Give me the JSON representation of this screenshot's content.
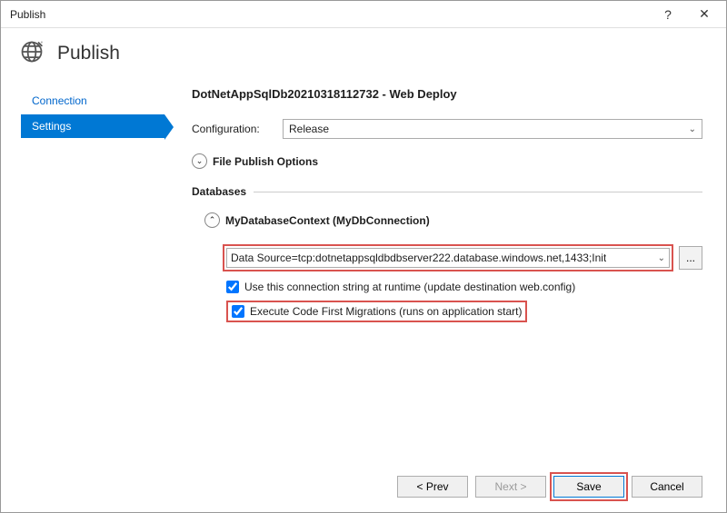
{
  "window": {
    "title": "Publish"
  },
  "titlebar": {
    "help_symbol": "?",
    "close_symbol": "✕"
  },
  "header": {
    "title": "Publish"
  },
  "sidebar": {
    "items": [
      {
        "label": "Connection",
        "active": false
      },
      {
        "label": "Settings",
        "active": true
      }
    ]
  },
  "main": {
    "page_title": "DotNetAppSqlDb20210318112732 - Web Deploy",
    "configuration_label": "Configuration:",
    "configuration_value": "Release",
    "file_publish_options_label": "File Publish Options",
    "databases": {
      "section_label": "Databases",
      "context_label": "MyDatabaseContext (MyDbConnection)",
      "connection_string": "Data Source=tcp:dotnetappsqldbdbserver222.database.windows.net,1433;Init",
      "ellipsis_label": "...",
      "use_connstr_label": "Use this connection string at runtime (update destination web.config)",
      "use_connstr_checked": true,
      "execute_migrations_label": "Execute Code First Migrations (runs on application start)",
      "execute_migrations_checked": true
    }
  },
  "footer": {
    "prev_label": "< Prev",
    "next_label": "Next >",
    "save_label": "Save",
    "cancel_label": "Cancel"
  }
}
